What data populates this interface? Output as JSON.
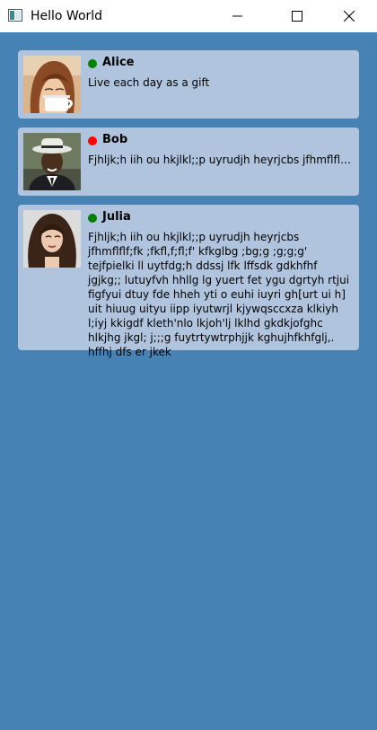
{
  "window": {
    "title": "Hello World",
    "controls": {
      "minimize": "minimize-icon",
      "maximize": "maximize-icon",
      "close": "close-icon"
    }
  },
  "colors": {
    "background": "#4682b4",
    "card": "#b0c4de",
    "online": "#008000",
    "busy": "#ff0000"
  },
  "contacts": [
    {
      "name": "Alice",
      "status": "online",
      "status_color": "#008000",
      "message": "Live each day as a gift"
    },
    {
      "name": "Bob",
      "status": "busy",
      "status_color": "#ff0000",
      "message": "Fjhljk;h iih  ou hkjlkl;;p uyrudjh heyrjcbs jfhmflflf;fk ;fkfl,f;fl;f' kfkglbg ;bg;g ;g;g;g' tejfpielki ll uytfdg;h ddssj lfk lffsdk gdkhfhf jgjkg;; lutuyfvh hhllg lg yuert fet ygu dgrtyh rtjui figfyui dtuy fde hheh yti o euhi iuyri gh[urt ui h] uit hiuug uityu iipp iyutwrjl kjywqsccxza klkiyh l;iyj kkigdf  kleth'nlo lkjoh'lj lklhd gkdkjofghc hlkjhg jkgl; j;;;g fuytrtywtrphjjk kghujhfkhfglj,. hffhj dfs er jkek"
    },
    {
      "name": "Julia",
      "status": "online",
      "status_color": "#008000",
      "message": "Fjhljk;h iih  ou hkjlkl;;p uyrudjh heyrjcbs jfhmflflf;fk ;fkfl,f;fl;f' kfkglbg ;bg;g ;g;g;g' tejfpielki ll uytfdg;h ddssj lfk lffsdk gdkhfhf jgjkg;; lutuyfvh hhllg lg yuert fet ygu dgrtyh rtjui figfyui dtuy fde hheh yti o euhi iuyri gh[urt ui h] uit hiuug uityu iipp iyutwrjl kjywqsccxza klkiyh l;iyj kkigdf  kleth'nlo lkjoh'lj lklhd gkdkjofghc hlkjhg jkgl; j;;;g fuytrtywtrphjjk kghujhfkhfglj,. hffhj dfs er jkek"
    }
  ]
}
